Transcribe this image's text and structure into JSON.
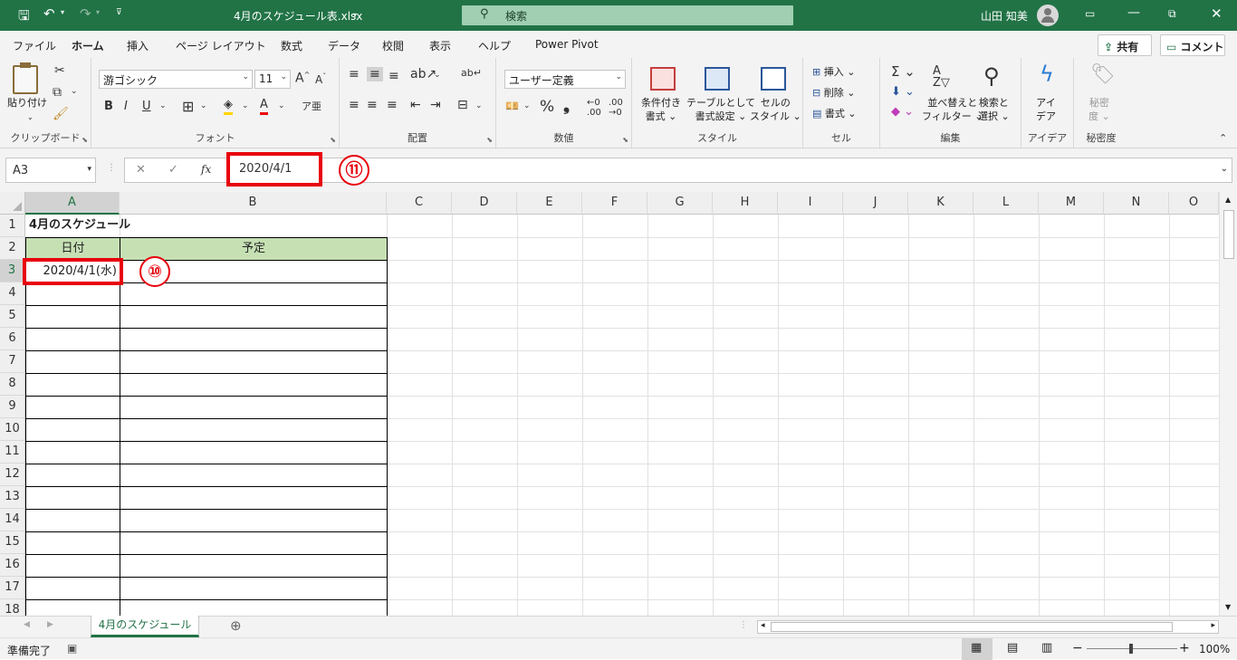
{
  "title": {
    "filename": "4月のスケジュール表.xlsx",
    "search_placeholder": "検索",
    "user": "山田 知美"
  },
  "tabs": [
    "ファイル",
    "ホーム",
    "挿入",
    "ページ レイアウト",
    "数式",
    "データ",
    "校閲",
    "表示",
    "ヘルプ",
    "Power Pivot"
  ],
  "share_label": "共有",
  "comment_label": "コメント",
  "ribbon": {
    "clipboard": {
      "label": "クリップボード",
      "paste": "貼り付け"
    },
    "font": {
      "label": "フォント",
      "name": "游ゴシック",
      "size": "11"
    },
    "alignment": {
      "label": "配置"
    },
    "number": {
      "label": "数値",
      "format": "ユーザー定義"
    },
    "styles": {
      "label": "スタイル",
      "cond1": "条件付き",
      "cond2": "書式",
      "table1": "テーブルとして",
      "table2": "書式設定",
      "cell1": "セルの",
      "cell2": "スタイル"
    },
    "cells": {
      "label": "セル",
      "insert": "挿入",
      "delete": "削除",
      "format": "書式"
    },
    "editing": {
      "label": "編集",
      "sort1": "並べ替えと",
      "sort2": "フィルター",
      "find1": "検索と",
      "find2": "選択"
    },
    "ideas": {
      "label": "アイデア",
      "btn1": "アイ",
      "btn2": "デア"
    },
    "sensitivity": {
      "label": "秘密度",
      "btn1": "秘密",
      "btn2": "度"
    }
  },
  "formula_bar": {
    "name_box": "A3",
    "value": "2020/4/1"
  },
  "annotations": {
    "a10": "⑩",
    "a11": "⑪"
  },
  "columns": [
    "A",
    "B",
    "C",
    "D",
    "E",
    "F",
    "G",
    "H",
    "I",
    "J",
    "K",
    "L",
    "M",
    "N",
    "O"
  ],
  "rows": [
    "1",
    "2",
    "3",
    "4",
    "5",
    "6",
    "7",
    "8",
    "9",
    "10",
    "11",
    "12",
    "13",
    "14",
    "15",
    "16",
    "17",
    "18"
  ],
  "cells": {
    "a1": "4月のスケジュール",
    "a2": "日付",
    "b2": "予定",
    "a3": "2020/4/1(水)"
  },
  "sheet_tab": "4月のスケジュール",
  "status": {
    "ready": "準備完了",
    "zoom": "100%"
  },
  "colors": {
    "accent": "#217346",
    "highlight": "#e8000b",
    "header_fill": "#c6e0b4"
  }
}
